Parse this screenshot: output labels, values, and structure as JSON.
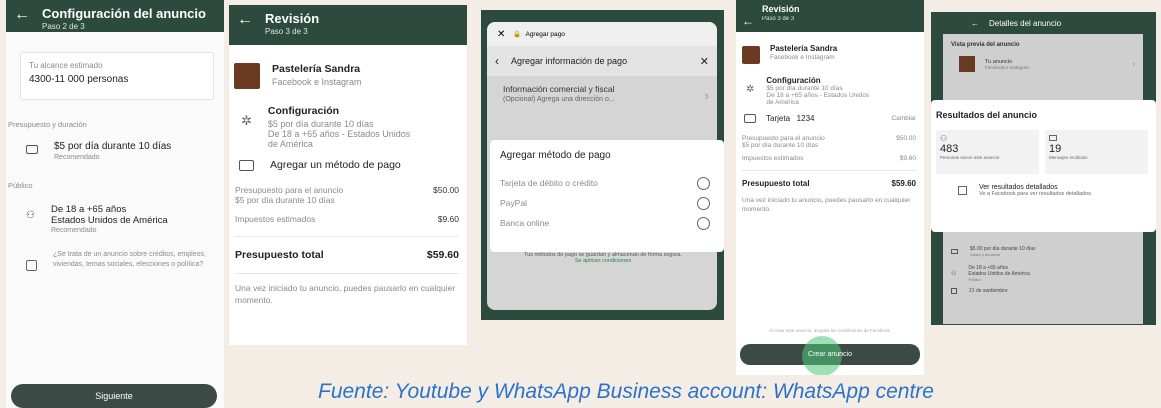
{
  "s1": {
    "title": "Configuración del anuncio",
    "step": "Paso 2 de 3",
    "reach_label": "Tu alcance estimado",
    "reach_value": "4300-11 000 personas",
    "budget_section": "Presupuesto y duración",
    "budget_value": "$5 por día durante 10 días",
    "budget_sub": "Recomendado",
    "audience_section": "Público",
    "audience_line1": "De 18 a +65 años",
    "audience_line2": "Estados Unidos de América",
    "audience_sub": "Recomendado",
    "check_text": "¿Se trata de un anuncio sobre créditos, empleos, viviendas, temas sociales, elecciones o política?",
    "next_btn": "Siguiente"
  },
  "s2": {
    "title": "Revisión",
    "step": "Paso 3 de 3",
    "business": "Pastelería Sandra",
    "platforms": "Facebook e Instagram",
    "config_title": "Configuración",
    "config_l1": "$5 por día durante 10 días",
    "config_l2": "De 18 a +65 años - Estados Unidos",
    "config_l3": "de América",
    "add_payment": "Agregar un método de pago",
    "budget_label": "Presupuesto para el anuncio",
    "budget_sub": "$5 por día durante 10 días",
    "budget_val": "$50.00",
    "tax_label": "Impuestos estimados",
    "tax_val": "$9.60",
    "total_label": "Presupuesto total",
    "total_val": "$59.60",
    "note": "Una vez iniciado tu anuncio, puedes pausarlo en cualquier momento."
  },
  "s3": {
    "url": "Agregar pago",
    "nav_title": "Agregar información de pago",
    "info_title": "Información comercial y fiscal",
    "info_sub": "(Opcional) Agrega una dirección o...",
    "method_title": "Agregar método de pago",
    "opt1": "Tarjeta de débito o crédito",
    "opt2": "PayPal",
    "opt3": "Banca online",
    "secure_text": "Tus métodos de pago se guardan y almacenan de forma segura.",
    "conditions": "Se aplican condiciones"
  },
  "s4": {
    "title": "Revisión",
    "step": "Paso 3 de 3",
    "business": "Pastelería Sandra",
    "platforms": "Facebook e Instagram",
    "config_title": "Configuración",
    "config_l1": "$5 por día durante 10 días",
    "config_l2": "De 18 a +65 años - Estados Unidos",
    "config_l3": "de América",
    "card": "Tarjeta   1234",
    "change": "Cambiar",
    "budget_label": "Presupuesto para el anuncio",
    "budget_sub": "$5 por día durante 10 días",
    "budget_val": "$50.00",
    "tax_label": "Impuestos estimados",
    "tax_val": "$9.60",
    "total_label": "Presupuesto total",
    "total_val": "$59.60",
    "note": "Una vez iniciado tu anuncio, puedes pausarlo en cualquier momento.",
    "terms": "Al crear este anuncio, aceptas las Condiciones de Facebook.",
    "create_btn": "Crear anuncio"
  },
  "s5": {
    "title": "Detalles del anuncio",
    "preview_label": "Vista previa del anuncio",
    "ad_title": "Tu anuncio",
    "ad_sub": "Facebook e Instagram",
    "results_title": "Resultados del anuncio",
    "people_val": "483",
    "people_label": "Personas vieron este anuncio",
    "msgs_val": "19",
    "msgs_label": "Mensajes recibidos",
    "detail_title": "Ver resultados detallados",
    "detail_sub": "Ve a Facebook para ver resultados detallados.",
    "budget_l1": "$5.00 por día durante 10 días",
    "budget_l2": "Gasto y duración",
    "aud_l1": "De 18 a +65 años",
    "aud_l2": "Estados Unidos de América",
    "aud_l3": "Público",
    "date": "21 de septiembre"
  },
  "caption": "Fuente: Youtube y WhatsApp Business account: WhatsApp centre"
}
